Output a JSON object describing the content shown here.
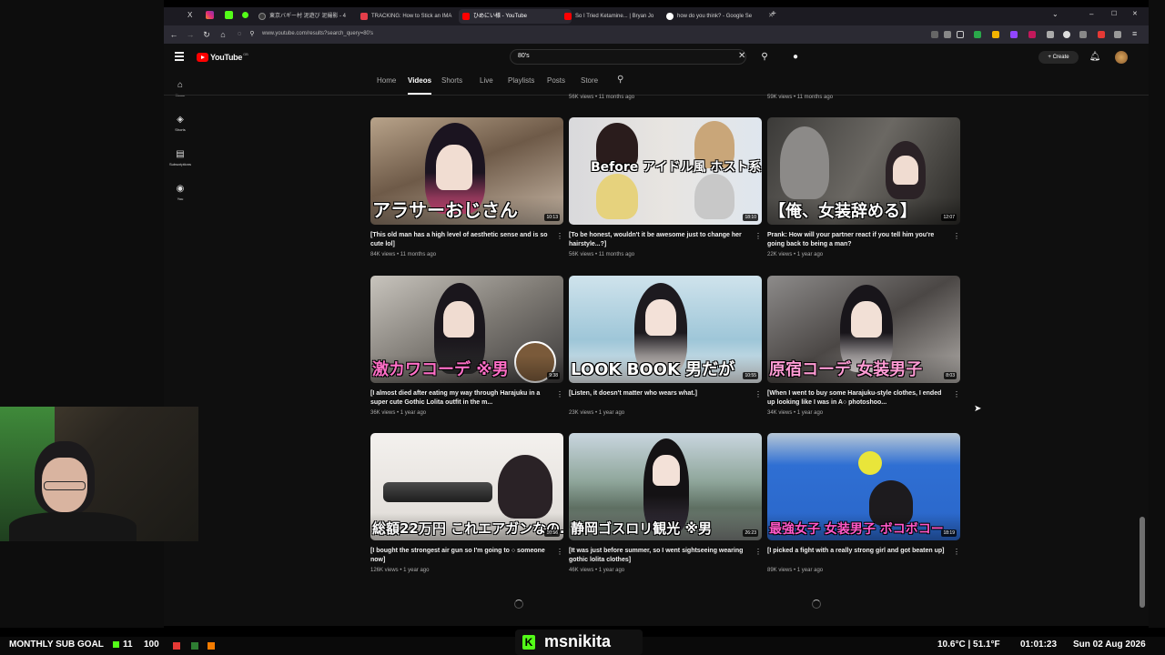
{
  "browser": {
    "tabs": [
      {
        "label": "東京バギー村 泥遊び 泥撮影 - 4",
        "color": "#3c3c3c"
      },
      {
        "label": "TRACKING: How to Stick an IMA",
        "color": "#e43e4a"
      },
      {
        "label": "ひめにい様 - YouTube",
        "color": "#ff0000",
        "active": true
      },
      {
        "label": "So I Tried Ketamine... | Bryan Jo",
        "color": "#ff0000"
      },
      {
        "label": "how do you think? - Google Se",
        "color": "#4285f4"
      }
    ],
    "url": "www.youtube.com/results?search_query=80's",
    "new_tab": "+",
    "window_controls": [
      "⌄",
      "–",
      "☐",
      "✕"
    ]
  },
  "youtube": {
    "logo_text": "YouTube",
    "logo_region": "GB",
    "search_value": "80's",
    "create_label": "Create",
    "sidenav": [
      {
        "icon": "⌂",
        "label": "Home"
      },
      {
        "icon": "◈",
        "label": "Shorts"
      },
      {
        "icon": "▤",
        "label": "Subscriptions"
      },
      {
        "icon": "◉",
        "label": "You"
      }
    ],
    "channel_tabs": [
      "Home",
      "Videos",
      "Shorts",
      "Live",
      "Playlists",
      "Posts",
      "Store"
    ],
    "partial_row_meta": [
      "56K views • 11 months ago",
      "59K views • 11 months ago"
    ],
    "videos": [
      {
        "title": "[This old man has a high level of aesthetic sense and is so cute lol]",
        "meta": "84K views • 11 months ago",
        "duration": "10:13",
        "overlay": "アラサーおじさん"
      },
      {
        "title": "[To be honest, wouldn't it be awesome just to change her hairstyle...?]",
        "meta": "56K views • 11 months ago",
        "duration": "18:10",
        "overlay": "Before アイドル風 ホスト系 クズ男"
      },
      {
        "title": "Prank: How will your partner react if you tell him you're going back to being a man?",
        "meta": "22K views • 1 year ago",
        "duration": "12:07",
        "overlay": "【俺、女装辞める】"
      },
      {
        "title": "[I almost died after eating my way through Harajuku in a super cute Gothic Lolita outfit in the m...",
        "meta": "36K views • 1 year ago",
        "duration": "9:38",
        "overlay": "激カワコーデ ※男"
      },
      {
        "title": "[Listen, it doesn't matter who wears what.]",
        "meta": "23K views • 1 year ago",
        "duration": "10:55",
        "overlay": "LOOK BOOK 男だが"
      },
      {
        "title": "[When I went to buy some Harajuku-style clothes, I ended up looking like I was in A○ photoshoo...",
        "meta": "34K views • 1 year ago",
        "duration": "8:03",
        "overlay": "原宿コーデ 女装男子"
      },
      {
        "title": "[I bought the strongest air gun so I'm going to ○ someone now]",
        "meta": "126K views • 1 year ago",
        "duration": "10:56",
        "overlay": "総額22万円 これエアガンなの…？"
      },
      {
        "title": "[It was just before summer, so I went sightseeing wearing gothic lolita clothes]",
        "meta": "46K views • 1 year ago",
        "duration": "26:23",
        "overlay": "静岡ゴスロリ観光 ※男"
      },
      {
        "title": "[I picked a fight with a really strong girl and got beaten up]",
        "meta": "89K views • 1 year ago",
        "duration": "18:19",
        "overlay": "最強女子 女装男子 ボコボコー"
      }
    ]
  },
  "stream": {
    "sub_goal_label": "MONTHLY SUB GOAL",
    "sub_current": "11",
    "sub_target": "100",
    "channel_name": "msnikita",
    "weather": "10.6°C | 51.1°F",
    "time": "01:01:23",
    "date": "Sun 02 Aug 2026"
  }
}
